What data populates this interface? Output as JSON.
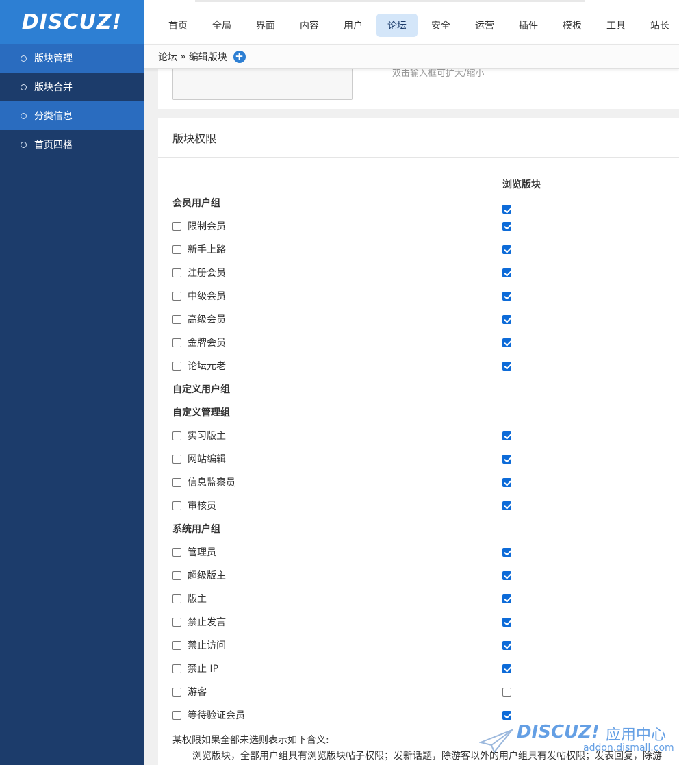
{
  "logo": "DISCUZ!",
  "sidebar": {
    "items": [
      {
        "label": "版块管理",
        "active": true
      },
      {
        "label": "版块合并",
        "active": false
      },
      {
        "label": "分类信息",
        "active": true
      },
      {
        "label": "首页四格",
        "active": false
      }
    ]
  },
  "topnav": {
    "tabs": [
      {
        "label": "首页",
        "active": false
      },
      {
        "label": "全局",
        "active": false
      },
      {
        "label": "界面",
        "active": false
      },
      {
        "label": "内容",
        "active": false
      },
      {
        "label": "用户",
        "active": false
      },
      {
        "label": "论坛",
        "active": true
      },
      {
        "label": "安全",
        "active": false
      },
      {
        "label": "运营",
        "active": false
      },
      {
        "label": "插件",
        "active": false
      },
      {
        "label": "模板",
        "active": false
      },
      {
        "label": "工具",
        "active": false
      },
      {
        "label": "站长",
        "active": false
      }
    ]
  },
  "breadcrumb": {
    "root": "论坛",
    "separator": "»",
    "current": "编辑版块"
  },
  "upper_panel": {
    "hint": "双击输入框可扩大/缩小"
  },
  "permissions": {
    "title": "版块权限",
    "column_header": "浏览版块",
    "column_header_checked": true,
    "groups": [
      {
        "title": "会员用户组",
        "items": [
          {
            "name": "限制会员",
            "selected": false,
            "view": true
          },
          {
            "name": "新手上路",
            "selected": false,
            "view": true
          },
          {
            "name": "注册会员",
            "selected": false,
            "view": true
          },
          {
            "name": "中级会员",
            "selected": false,
            "view": true
          },
          {
            "name": "高级会员",
            "selected": false,
            "view": true
          },
          {
            "name": "金牌会员",
            "selected": false,
            "view": true
          },
          {
            "name": "论坛元老",
            "selected": false,
            "view": true
          }
        ]
      },
      {
        "title": "自定义用户组",
        "items": []
      },
      {
        "title": "自定义管理组",
        "items": [
          {
            "name": "实习版主",
            "selected": false,
            "view": true
          },
          {
            "name": "网站编辑",
            "selected": false,
            "view": true
          },
          {
            "name": "信息监察员",
            "selected": false,
            "view": true
          },
          {
            "name": "审核员",
            "selected": false,
            "view": true
          }
        ]
      },
      {
        "title": "系统用户组",
        "items": [
          {
            "name": "管理员",
            "selected": false,
            "view": true
          },
          {
            "name": "超级版主",
            "selected": false,
            "view": true
          },
          {
            "name": "版主",
            "selected": false,
            "view": true
          },
          {
            "name": "禁止发言",
            "selected": false,
            "view": true
          },
          {
            "name": "禁止访问",
            "selected": false,
            "view": true
          },
          {
            "name": "禁止 IP",
            "selected": false,
            "view": true
          },
          {
            "name": "游客",
            "selected": false,
            "view": false
          },
          {
            "name": "等待验证会员",
            "selected": false,
            "view": true
          }
        ]
      }
    ],
    "note_title": "某权限如果全部未选则表示如下含义:",
    "note_text": "浏览版块，全部用户组具有浏览版块帖子权限；发新话题，除游客以外的用户组具有发帖权限；发表回复，除游"
  },
  "watermark": {
    "logo": "DISCUZ!",
    "text": "应用中心",
    "url": "addon.dismall.com"
  },
  "colors": {
    "sidebar": "#1c3c6b",
    "logo_bg": "#2d7fd3",
    "active_item": "#2a6cbf",
    "active_tab": "#d4e6f9",
    "checkbox": "#0d6bd8"
  }
}
